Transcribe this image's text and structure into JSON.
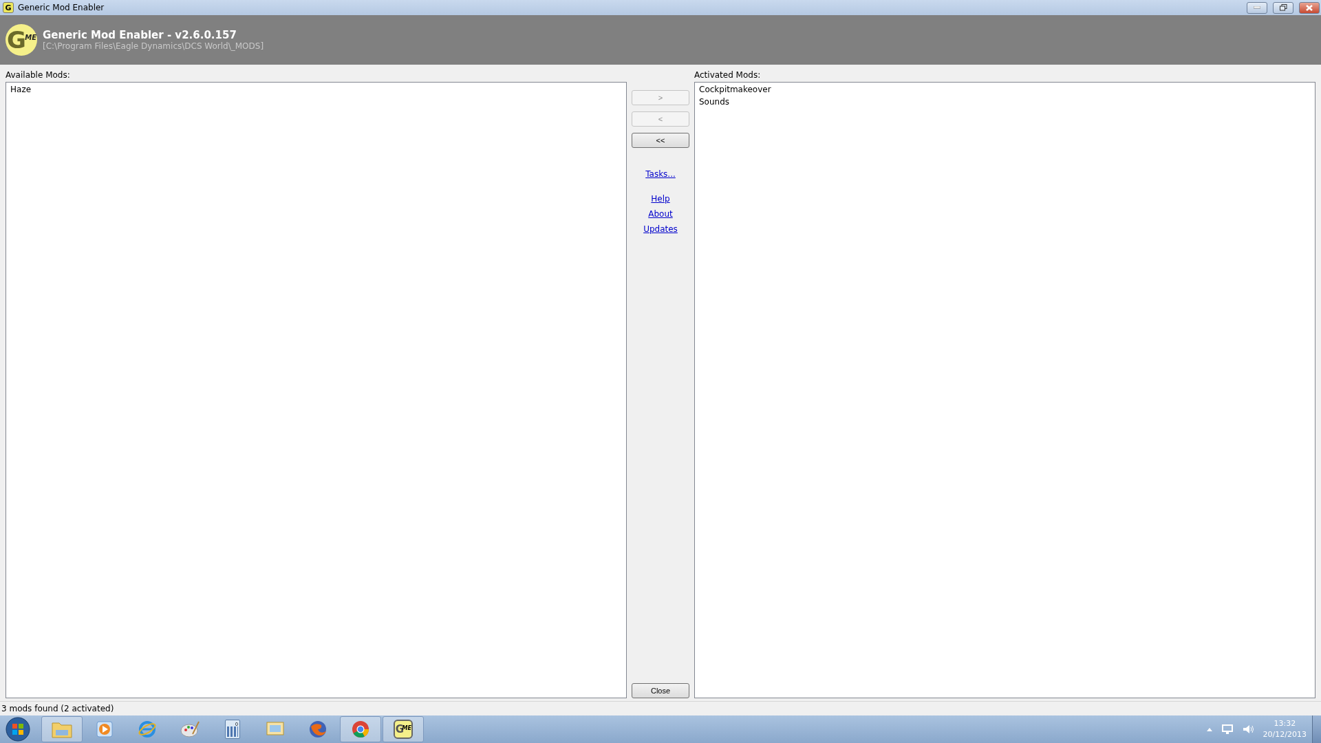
{
  "window": {
    "title": "Generic Mod Enabler",
    "icon_letter": "G"
  },
  "header": {
    "logo": {
      "letter": "G",
      "sub": "ME"
    },
    "title": "Generic Mod Enabler - v2.6.0.157",
    "path": "[C:\\Program Files\\Eagle Dynamics\\DCS World\\_MODS]"
  },
  "available": {
    "label": "Available Mods:",
    "items": [
      "Haze"
    ]
  },
  "actions": {
    "buttons": [
      {
        "label": ">",
        "disabled": true
      },
      {
        "label": "<",
        "disabled": true
      },
      {
        "label": "<<",
        "disabled": false
      }
    ],
    "link_groups": [
      [
        "Tasks..."
      ],
      [
        "Help",
        "About",
        "Updates"
      ]
    ],
    "close": "Close"
  },
  "activated": {
    "label": "Activated Mods:",
    "items": [
      "Cockpitmakeover",
      "Sounds"
    ]
  },
  "status_bar": "3 mods found (2 activated)",
  "taskbar": {
    "items": [
      {
        "kind": "folder",
        "running": true
      },
      {
        "kind": "media",
        "running": false
      },
      {
        "kind": "browser-e",
        "running": false
      },
      {
        "kind": "palette",
        "running": false
      },
      {
        "kind": "calculator",
        "running": false,
        "digit": "0"
      },
      {
        "kind": "mail",
        "running": false
      },
      {
        "kind": "fox",
        "running": false
      },
      {
        "kind": "chrome",
        "running": true
      },
      {
        "kind": "gme",
        "running": true,
        "letter": "G",
        "sub": "ME"
      }
    ],
    "time": "13:32",
    "date": "20/12/2013"
  }
}
